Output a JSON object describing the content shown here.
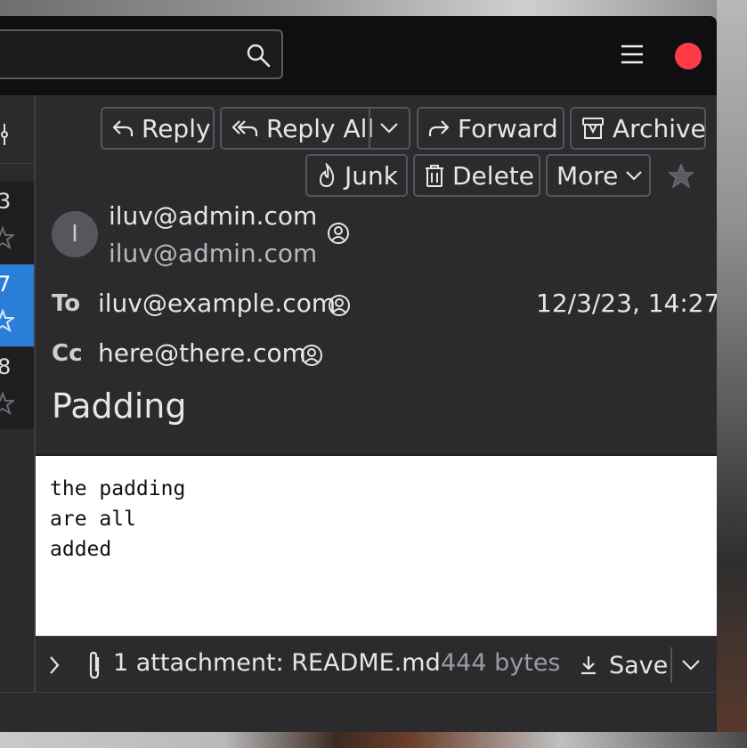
{
  "toolbar": {
    "reply_label": "Reply",
    "reply_all_label": "Reply All",
    "forward_label": "Forward",
    "archive_label": "Archive",
    "junk_label": "Junk",
    "delete_label": "Delete",
    "more_label": "More"
  },
  "message_list": {
    "rows": [
      {
        "num": "3",
        "selected": false
      },
      {
        "num": "7",
        "selected": true
      },
      {
        "num": "8",
        "selected": false
      }
    ]
  },
  "header": {
    "avatar_initial": "I",
    "from_name": "iluv@admin.com",
    "from_address": "iluv@admin.com",
    "to_label": "To",
    "to_value": "iluv@example.com",
    "date": "12/3/23, 14:27",
    "cc_label": "Cc",
    "cc_value": "here@there.com",
    "subject": "Padding"
  },
  "body": {
    "lines": [
      "the padding",
      "are all",
      "added"
    ]
  },
  "attachment": {
    "summary": "1 attachment: README.md",
    "size": "444 bytes",
    "save_label": "Save"
  },
  "colors": {
    "accent": "#2a7ed8",
    "close": "#ff3b48"
  }
}
